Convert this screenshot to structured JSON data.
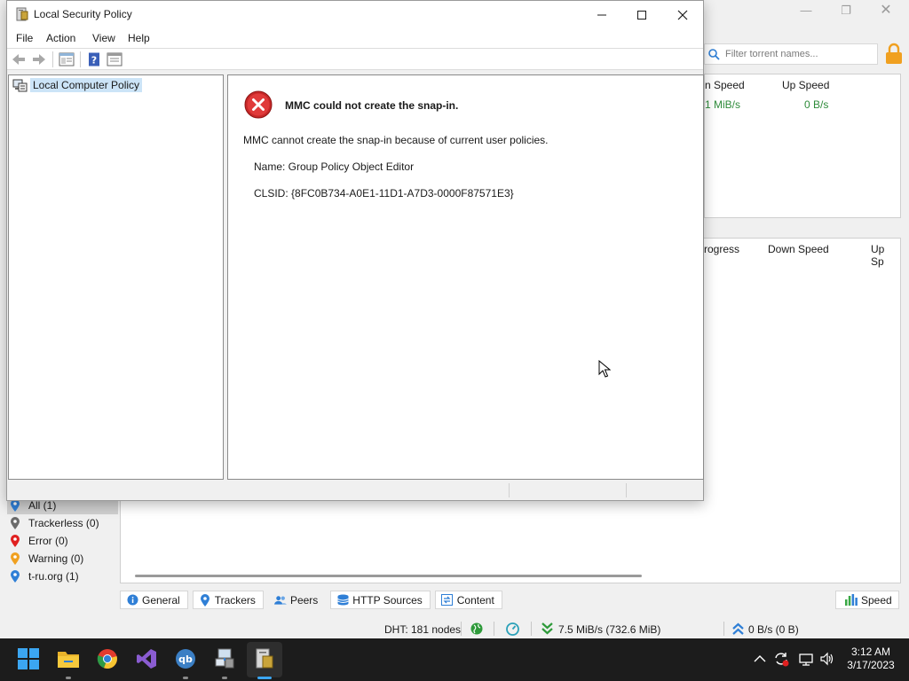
{
  "qbittorrent": {
    "search_placeholder": "Filter torrent names...",
    "top_pane": {
      "col_down": "n Speed",
      "col_up": "Up Speed",
      "down_value": "1 MiB/s",
      "up_value": "0 B/s"
    },
    "bottom_pane": {
      "col_progress": "rogress",
      "col_down": "Down Speed",
      "col_up": "Up Sp"
    },
    "filters": [
      {
        "label": "All (1)",
        "color": "#2f7fd6"
      },
      {
        "label": "Trackerless (0)",
        "color": "#6a6a6a"
      },
      {
        "label": "Error (0)",
        "color": "#e02020"
      },
      {
        "label": "Warning (0)",
        "color": "#f0a020"
      },
      {
        "label": "t-ru.org (1)",
        "color": "#2f7fd6"
      }
    ],
    "tabs": [
      "General",
      "Trackers",
      "Peers",
      "HTTP Sources",
      "Content"
    ],
    "speed_button": "Speed",
    "status": {
      "dht": "DHT: 181 nodes",
      "download": "7.5 MiB/s (732.6 MiB)",
      "upload": "0 B/s (0 B)"
    }
  },
  "lsp": {
    "title": "Local Security Policy",
    "menu": [
      "File",
      "Action",
      "View",
      "Help"
    ],
    "tree_root": "Local Computer Policy",
    "error": {
      "title": "MMC could not create the snap-in.",
      "message": "MMC cannot create the snap-in because of current user policies.",
      "name": "Name: Group Policy Object Editor",
      "clsid": "CLSID: {8FC0B734-A0E1-11D1-A7D3-0000F87571E3}"
    }
  },
  "taskbar": {
    "apps": [
      "windows-start-icon",
      "file-explorer-icon",
      "chrome-icon",
      "visual-studio-icon",
      "qbittorrent-icon",
      "network-tool-icon",
      "security-policy-icon"
    ],
    "clock": {
      "time": "3:12 AM",
      "date": "3/17/2023"
    }
  }
}
